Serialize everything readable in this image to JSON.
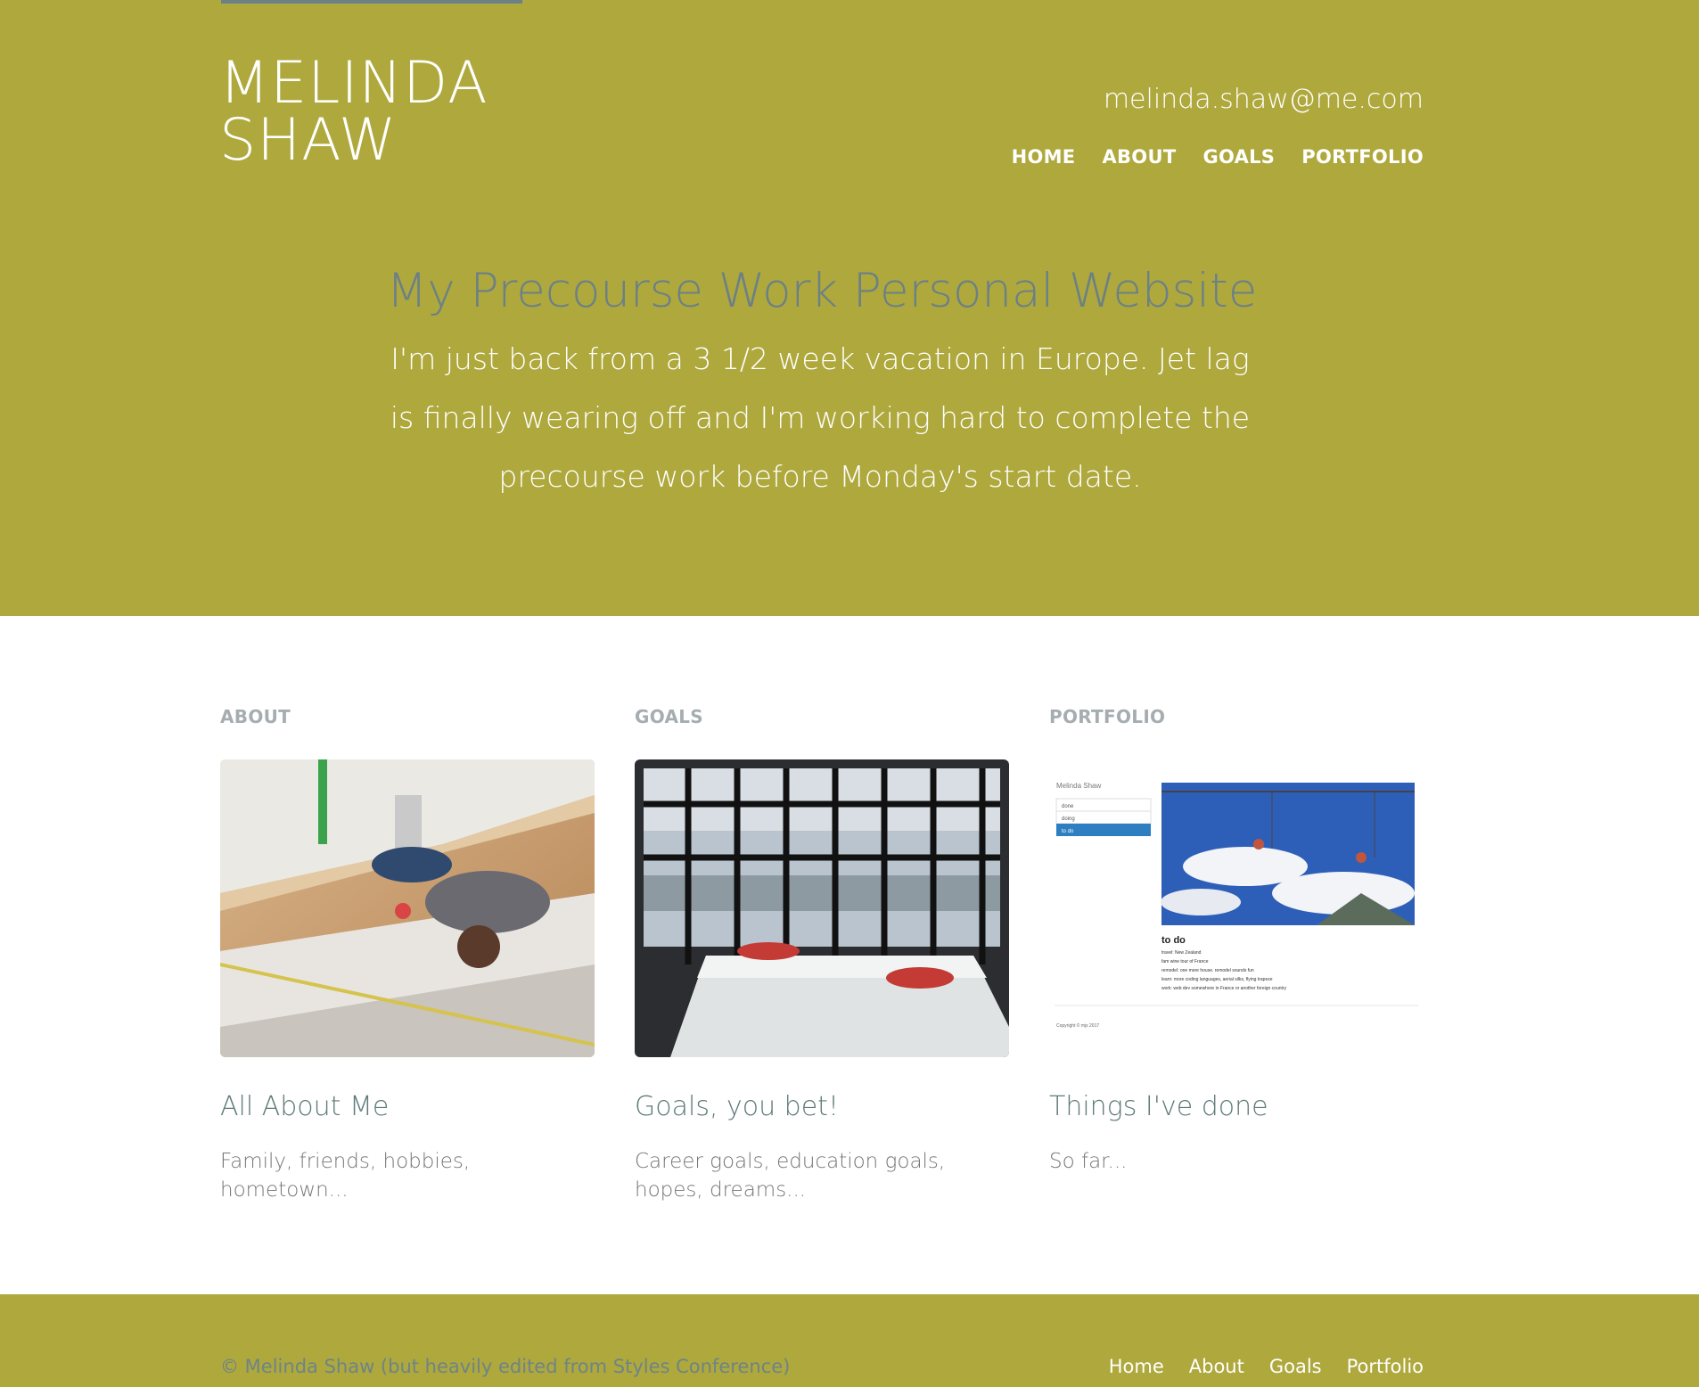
{
  "header": {
    "name_line1": "MELINDA",
    "name_line2": "SHAW",
    "email": "melinda.shaw@me.com",
    "nav": [
      "HOME",
      "ABOUT",
      "GOALS",
      "PORTFOLIO"
    ]
  },
  "hero": {
    "title": "My Precourse Work Personal Website",
    "text": "I'm just back from a 3 1/2 week vacation in Europe. Jet lag is finally wearing off and I'm working hard to complete the precourse work before Monday's start date."
  },
  "cards": [
    {
      "label": "ABOUT",
      "title": "All About Me",
      "text": "Family, friends, hobbies, hometown..."
    },
    {
      "label": "GOALS",
      "title": "Goals, you bet!",
      "text": "Career goals, education goals, hopes, dreams..."
    },
    {
      "label": "PORTFOLIO",
      "title": "Things I've done",
      "text": "So far...",
      "thumbnail": {
        "site_name": "Melinda Shaw",
        "menu": [
          "done",
          "doing",
          "to do"
        ],
        "heading": "to do",
        "lines": [
          "travel: New Zealand",
          "fam wine tour of France",
          "remodel: one more house. remodel sounds fun",
          "learn: more coding languages, aerial silks, flying trapeze",
          "work: web dev somewhere in France or another foreign country"
        ],
        "copyright": "Copyright © mjs 2017"
      }
    }
  ],
  "footer": {
    "copyright": "© Melinda Shaw (but heavily edited from Styles Conference)",
    "nav": [
      "Home",
      "About",
      "Goals",
      "Portfolio"
    ]
  },
  "colors": {
    "olive": "#aea83d",
    "slate": "#6b8087",
    "white": "#ffffff"
  }
}
